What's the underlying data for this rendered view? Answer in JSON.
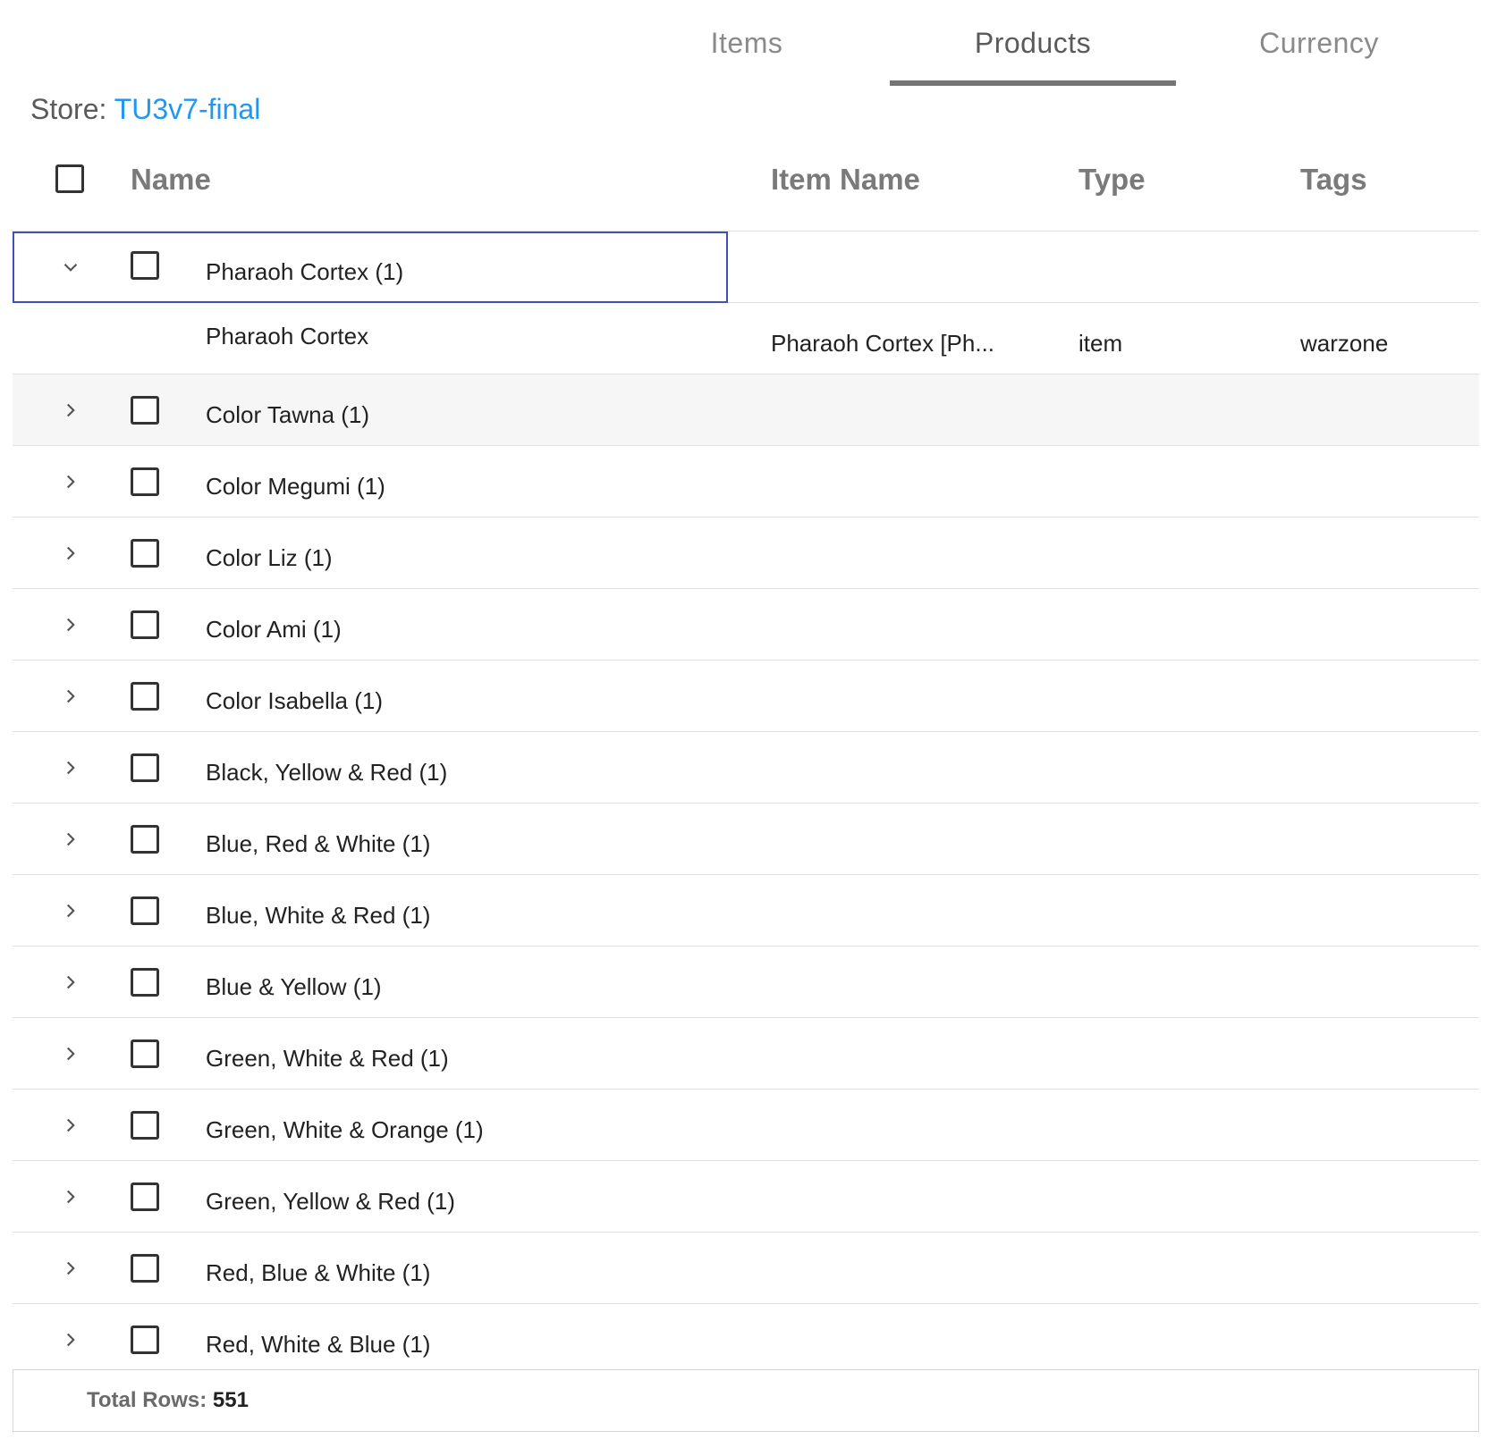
{
  "tabs": [
    {
      "label": "Items",
      "active": false
    },
    {
      "label": "Products",
      "active": true
    },
    {
      "label": "Currency",
      "active": false
    }
  ],
  "store": {
    "label": "Store:",
    "name": "TU3v7-final"
  },
  "columns": {
    "name": "Name",
    "item_name": "Item Name",
    "type": "Type",
    "tags": "Tags"
  },
  "rows": [
    {
      "label": "Pharaoh Cortex (1)",
      "expanded": true
    },
    {
      "label": "Pharaoh Cortex",
      "child": true,
      "item_name": "Pharaoh Cortex [Ph...",
      "type": "item",
      "tags": "warzone"
    },
    {
      "label": "Color Tawna (1)"
    },
    {
      "label": "Color Megumi (1)"
    },
    {
      "label": "Color Liz (1)"
    },
    {
      "label": "Color Ami (1)"
    },
    {
      "label": "Color Isabella (1)"
    },
    {
      "label": "Black, Yellow & Red (1)"
    },
    {
      "label": "Blue, Red & White (1)"
    },
    {
      "label": "Blue, White & Red (1)"
    },
    {
      "label": "Blue & Yellow (1)"
    },
    {
      "label": "Green, White & Red (1)"
    },
    {
      "label": "Green, White & Orange (1)"
    },
    {
      "label": "Green, Yellow & Red (1)"
    },
    {
      "label": "Red, Blue & White (1)"
    },
    {
      "label": "Red, White & Blue (1)"
    }
  ],
  "footer": {
    "label": "Total Rows:",
    "count": "551"
  },
  "colors": {
    "accent": "#2196f3",
    "focus": "#3f51b5",
    "tab_indicator": "#757575"
  }
}
